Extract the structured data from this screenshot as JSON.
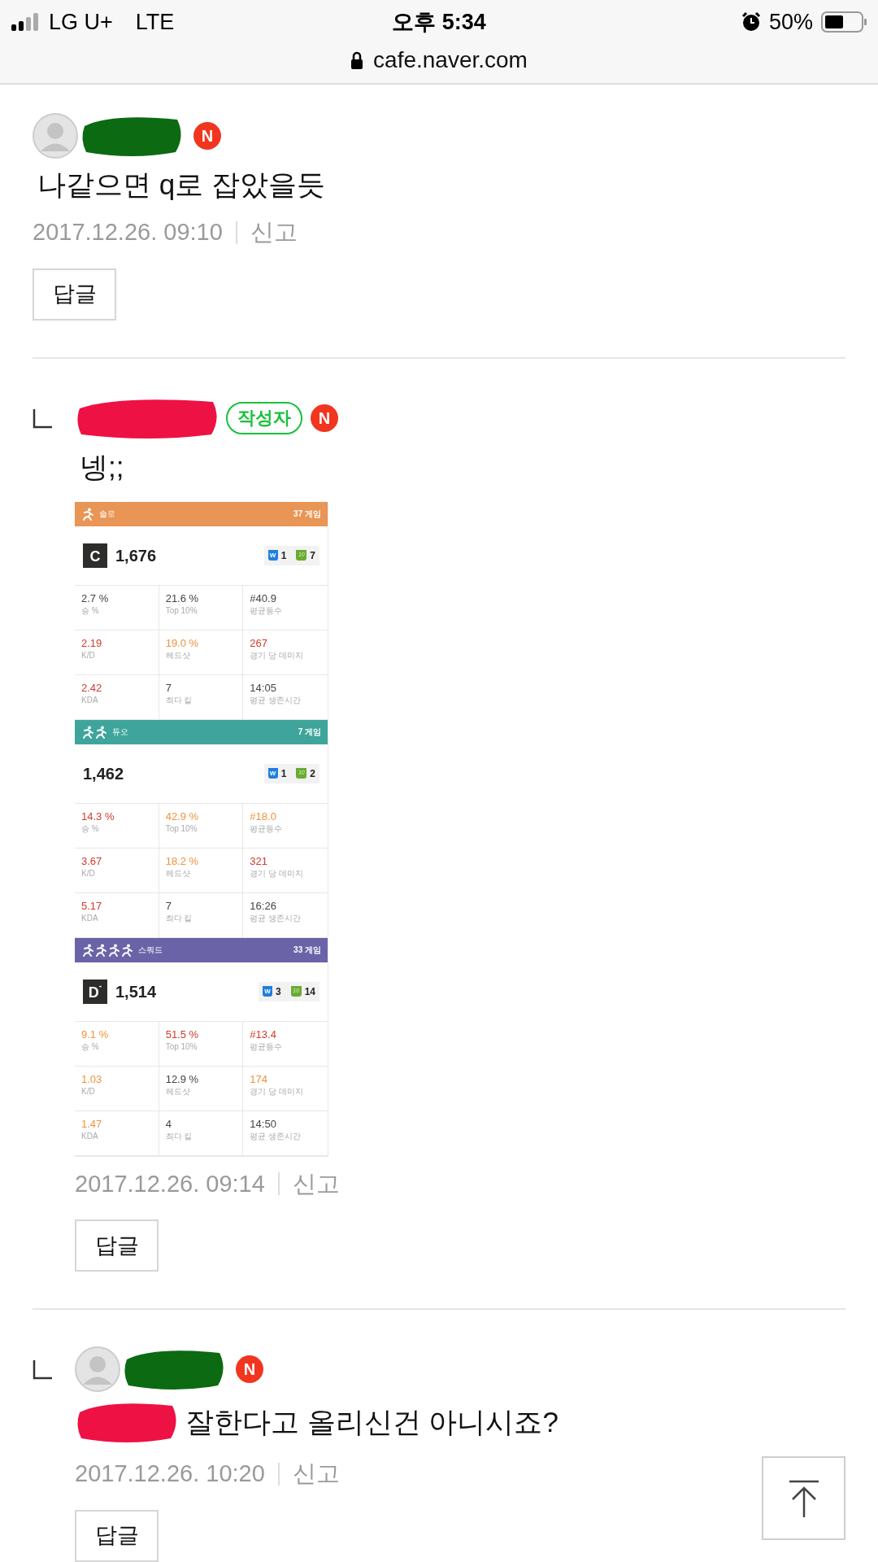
{
  "status_bar": {
    "carrier": "LG U+",
    "network": "LTE",
    "time": "오후 5:34",
    "battery": "50%",
    "url": "cafe.naver.com"
  },
  "comments": [
    {
      "reply": false,
      "avatar": true,
      "new_badge": "N",
      "redacted_text": false,
      "text": "나같으면 q로 잡았을듯",
      "date": "2017.12.26. 09:10",
      "report": "신고",
      "reply_button": "답글"
    },
    {
      "reply": true,
      "avatar": false,
      "writer_badge": "작성자",
      "new_badge": "N",
      "redacted_text": false,
      "text": "넹;;",
      "date": "2017.12.26. 09:14",
      "report": "신고",
      "reply_button": "답글",
      "stats_image": {
        "sections": [
          {
            "kind": "solo",
            "mode": "솔로",
            "games": "37 게임",
            "color": "#e89555",
            "tier": "C",
            "rating": "1,676",
            "win_icon": "W",
            "wins": "1",
            "top10_icon": "10",
            "top10": "7",
            "stats": [
              {
                "value": "2.7 %",
                "label": "승 %",
                "color": "#444444"
              },
              {
                "value": "21.6 %",
                "label": "Top 10%",
                "color": "#444444"
              },
              {
                "value": "#40.9",
                "label": "평균등수",
                "color": "#444444"
              },
              {
                "value": "2.19",
                "label": "K/D",
                "color": "#d13b2b"
              },
              {
                "value": "19.0 %",
                "label": "헤드샷",
                "color": "#f0923f"
              },
              {
                "value": "267",
                "label": "경기 당 데미지",
                "color": "#d13b2b"
              },
              {
                "value": "2.42",
                "label": "KDA",
                "color": "#d13b2b"
              },
              {
                "value": "7",
                "label": "최다 킬",
                "color": "#444444"
              },
              {
                "value": "14:05",
                "label": "평균 생존시간",
                "color": "#444444"
              }
            ]
          },
          {
            "kind": "duo",
            "mode": "듀오",
            "games": "7 게임",
            "color": "#3fa59c",
            "rating": "1,462",
            "win_icon": "W",
            "wins": "1",
            "top10_icon": "10",
            "top10": "2",
            "stats": [
              {
                "value": "14.3 %",
                "label": "승 %",
                "color": "#d13b2b"
              },
              {
                "value": "42.9 %",
                "label": "Top 10%",
                "color": "#f0923f"
              },
              {
                "value": "#18.0",
                "label": "평균등수",
                "color": "#f0923f"
              },
              {
                "value": "3.67",
                "label": "K/D",
                "color": "#d13b2b"
              },
              {
                "value": "18.2 %",
                "label": "헤드샷",
                "color": "#f0923f"
              },
              {
                "value": "321",
                "label": "경기 당 데미지",
                "color": "#d13b2b"
              },
              {
                "value": "5.17",
                "label": "KDA",
                "color": "#d13b2b"
              },
              {
                "value": "7",
                "label": "최다 킬",
                "color": "#444444"
              },
              {
                "value": "16:26",
                "label": "평균 생존시간",
                "color": "#444444"
              }
            ]
          },
          {
            "kind": "squad",
            "mode": "스쿼드",
            "games": "33 게임",
            "color": "#6b63a8",
            "tier": "D",
            "tier_mark": "-",
            "rating": "1,514",
            "win_icon": "W",
            "wins": "3",
            "top10_icon": "10",
            "top10": "14",
            "stats": [
              {
                "value": "9.1 %",
                "label": "승 %",
                "color": "#f0923f"
              },
              {
                "value": "51.5 %",
                "label": "Top 10%",
                "color": "#d13b2b"
              },
              {
                "value": "#13.4",
                "label": "평균등수",
                "color": "#d13b2b"
              },
              {
                "value": "1.03",
                "label": "K/D",
                "color": "#f0923f"
              },
              {
                "value": "12.9 %",
                "label": "헤드샷",
                "color": "#444444"
              },
              {
                "value": "174",
                "label": "경기 당 데미지",
                "color": "#f0923f"
              },
              {
                "value": "1.47",
                "label": "KDA",
                "color": "#f0923f"
              },
              {
                "value": "4",
                "label": "최다 킬",
                "color": "#444444"
              },
              {
                "value": "14:50",
                "label": "평균 생존시간",
                "color": "#444444"
              }
            ]
          }
        ]
      }
    },
    {
      "reply": true,
      "avatar": true,
      "new_badge": "N",
      "redacted_text": true,
      "text": "잘한다고 올리신건 아니시죠?",
      "date": "2017.12.26. 10:20",
      "report": "신고",
      "reply_button": "답글"
    }
  ],
  "scroll_top_button": true
}
